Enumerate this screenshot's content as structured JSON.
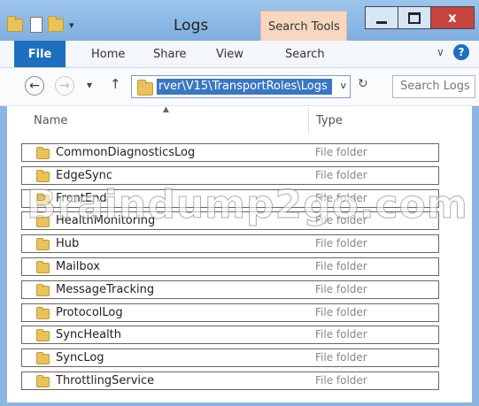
{
  "window": {
    "title": "Logs",
    "context_tab": "Search Tools",
    "close_glyph": "x"
  },
  "ribbon": {
    "tabs": [
      "File",
      "Home",
      "Share",
      "View",
      "Search"
    ]
  },
  "navigation": {
    "back_glyph": "←",
    "forward_glyph": "→",
    "recent_glyph": "▾",
    "up_glyph": "↑",
    "address_path": "rver\\V15\\TransportRoles\\Logs",
    "address_dropdown_glyph": "v",
    "refresh_glyph": "↻",
    "search_placeholder": "Search Logs"
  },
  "columns": {
    "name": "Name",
    "type": "Type"
  },
  "files": [
    {
      "name": "CommonDiagnosticsLog",
      "type": "File folder"
    },
    {
      "name": "EdgeSync",
      "type": "File folder"
    },
    {
      "name": "FrontEnd",
      "type": "File folder"
    },
    {
      "name": "HealthMonitoring",
      "type": "File folder"
    },
    {
      "name": "Hub",
      "type": "File folder"
    },
    {
      "name": "Mailbox",
      "type": "File folder"
    },
    {
      "name": "MessageTracking",
      "type": "File folder"
    },
    {
      "name": "ProtocolLog",
      "type": "File folder"
    },
    {
      "name": "SyncHealth",
      "type": "File folder"
    },
    {
      "name": "SyncLog",
      "type": "File folder"
    },
    {
      "name": "ThrottlingService",
      "type": "File folder"
    }
  ],
  "watermark": "Braindump2go.com",
  "colors": {
    "file_tab": "#1f6fc0",
    "address_selection": "#3a76c4",
    "close_button": "#c7453c",
    "context_tab": "#f7d7c0"
  }
}
